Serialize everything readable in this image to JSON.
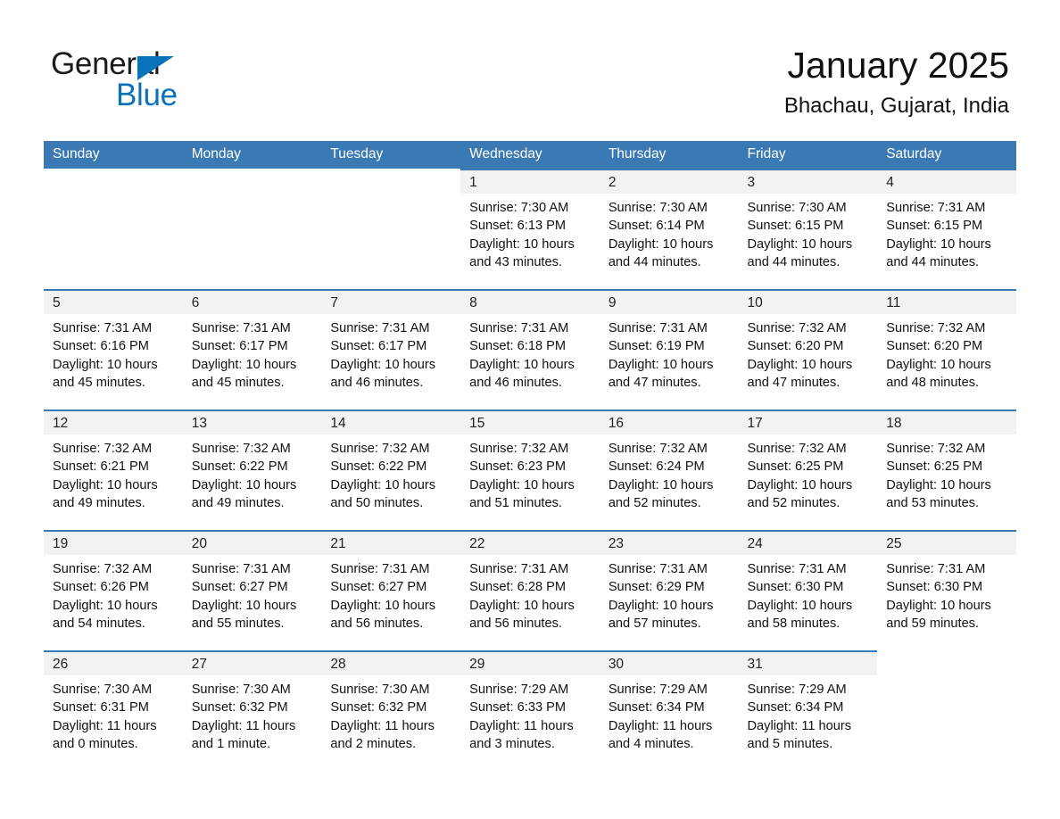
{
  "brand": {
    "name_part1": "General",
    "name_part2": "Blue",
    "accent_color": "#0a72b8"
  },
  "header": {
    "title": "January 2025",
    "subtitle": "Bhachau, Gujarat, India"
  },
  "theme": {
    "header_blue": "#3b79b5",
    "daynum_band": "#f2f2f2"
  },
  "weekday_headers": [
    "Sunday",
    "Monday",
    "Tuesday",
    "Wednesday",
    "Thursday",
    "Friday",
    "Saturday"
  ],
  "labels": {
    "sunrise_prefix": "Sunrise:",
    "sunset_prefix": "Sunset:",
    "daylight_prefix": "Daylight:"
  },
  "weeks": [
    [
      {
        "day": "",
        "blank": true
      },
      {
        "day": "",
        "blank": true
      },
      {
        "day": "",
        "blank": true
      },
      {
        "day": "1",
        "sunrise": "Sunrise: 7:30 AM",
        "sunset": "Sunset: 6:13 PM",
        "daylight_l1": "Daylight: 10 hours",
        "daylight_l2": "and 43 minutes."
      },
      {
        "day": "2",
        "sunrise": "Sunrise: 7:30 AM",
        "sunset": "Sunset: 6:14 PM",
        "daylight_l1": "Daylight: 10 hours",
        "daylight_l2": "and 44 minutes."
      },
      {
        "day": "3",
        "sunrise": "Sunrise: 7:30 AM",
        "sunset": "Sunset: 6:15 PM",
        "daylight_l1": "Daylight: 10 hours",
        "daylight_l2": "and 44 minutes."
      },
      {
        "day": "4",
        "sunrise": "Sunrise: 7:31 AM",
        "sunset": "Sunset: 6:15 PM",
        "daylight_l1": "Daylight: 10 hours",
        "daylight_l2": "and 44 minutes."
      }
    ],
    [
      {
        "day": "5",
        "sunrise": "Sunrise: 7:31 AM",
        "sunset": "Sunset: 6:16 PM",
        "daylight_l1": "Daylight: 10 hours",
        "daylight_l2": "and 45 minutes."
      },
      {
        "day": "6",
        "sunrise": "Sunrise: 7:31 AM",
        "sunset": "Sunset: 6:17 PM",
        "daylight_l1": "Daylight: 10 hours",
        "daylight_l2": "and 45 minutes."
      },
      {
        "day": "7",
        "sunrise": "Sunrise: 7:31 AM",
        "sunset": "Sunset: 6:17 PM",
        "daylight_l1": "Daylight: 10 hours",
        "daylight_l2": "and 46 minutes."
      },
      {
        "day": "8",
        "sunrise": "Sunrise: 7:31 AM",
        "sunset": "Sunset: 6:18 PM",
        "daylight_l1": "Daylight: 10 hours",
        "daylight_l2": "and 46 minutes."
      },
      {
        "day": "9",
        "sunrise": "Sunrise: 7:31 AM",
        "sunset": "Sunset: 6:19 PM",
        "daylight_l1": "Daylight: 10 hours",
        "daylight_l2": "and 47 minutes."
      },
      {
        "day": "10",
        "sunrise": "Sunrise: 7:32 AM",
        "sunset": "Sunset: 6:20 PM",
        "daylight_l1": "Daylight: 10 hours",
        "daylight_l2": "and 47 minutes."
      },
      {
        "day": "11",
        "sunrise": "Sunrise: 7:32 AM",
        "sunset": "Sunset: 6:20 PM",
        "daylight_l1": "Daylight: 10 hours",
        "daylight_l2": "and 48 minutes."
      }
    ],
    [
      {
        "day": "12",
        "sunrise": "Sunrise: 7:32 AM",
        "sunset": "Sunset: 6:21 PM",
        "daylight_l1": "Daylight: 10 hours",
        "daylight_l2": "and 49 minutes."
      },
      {
        "day": "13",
        "sunrise": "Sunrise: 7:32 AM",
        "sunset": "Sunset: 6:22 PM",
        "daylight_l1": "Daylight: 10 hours",
        "daylight_l2": "and 49 minutes."
      },
      {
        "day": "14",
        "sunrise": "Sunrise: 7:32 AM",
        "sunset": "Sunset: 6:22 PM",
        "daylight_l1": "Daylight: 10 hours",
        "daylight_l2": "and 50 minutes."
      },
      {
        "day": "15",
        "sunrise": "Sunrise: 7:32 AM",
        "sunset": "Sunset: 6:23 PM",
        "daylight_l1": "Daylight: 10 hours",
        "daylight_l2": "and 51 minutes."
      },
      {
        "day": "16",
        "sunrise": "Sunrise: 7:32 AM",
        "sunset": "Sunset: 6:24 PM",
        "daylight_l1": "Daylight: 10 hours",
        "daylight_l2": "and 52 minutes."
      },
      {
        "day": "17",
        "sunrise": "Sunrise: 7:32 AM",
        "sunset": "Sunset: 6:25 PM",
        "daylight_l1": "Daylight: 10 hours",
        "daylight_l2": "and 52 minutes."
      },
      {
        "day": "18",
        "sunrise": "Sunrise: 7:32 AM",
        "sunset": "Sunset: 6:25 PM",
        "daylight_l1": "Daylight: 10 hours",
        "daylight_l2": "and 53 minutes."
      }
    ],
    [
      {
        "day": "19",
        "sunrise": "Sunrise: 7:32 AM",
        "sunset": "Sunset: 6:26 PM",
        "daylight_l1": "Daylight: 10 hours",
        "daylight_l2": "and 54 minutes."
      },
      {
        "day": "20",
        "sunrise": "Sunrise: 7:31 AM",
        "sunset": "Sunset: 6:27 PM",
        "daylight_l1": "Daylight: 10 hours",
        "daylight_l2": "and 55 minutes."
      },
      {
        "day": "21",
        "sunrise": "Sunrise: 7:31 AM",
        "sunset": "Sunset: 6:27 PM",
        "daylight_l1": "Daylight: 10 hours",
        "daylight_l2": "and 56 minutes."
      },
      {
        "day": "22",
        "sunrise": "Sunrise: 7:31 AM",
        "sunset": "Sunset: 6:28 PM",
        "daylight_l1": "Daylight: 10 hours",
        "daylight_l2": "and 56 minutes."
      },
      {
        "day": "23",
        "sunrise": "Sunrise: 7:31 AM",
        "sunset": "Sunset: 6:29 PM",
        "daylight_l1": "Daylight: 10 hours",
        "daylight_l2": "and 57 minutes."
      },
      {
        "day": "24",
        "sunrise": "Sunrise: 7:31 AM",
        "sunset": "Sunset: 6:30 PM",
        "daylight_l1": "Daylight: 10 hours",
        "daylight_l2": "and 58 minutes."
      },
      {
        "day": "25",
        "sunrise": "Sunrise: 7:31 AM",
        "sunset": "Sunset: 6:30 PM",
        "daylight_l1": "Daylight: 10 hours",
        "daylight_l2": "and 59 minutes."
      }
    ],
    [
      {
        "day": "26",
        "sunrise": "Sunrise: 7:30 AM",
        "sunset": "Sunset: 6:31 PM",
        "daylight_l1": "Daylight: 11 hours",
        "daylight_l2": "and 0 minutes."
      },
      {
        "day": "27",
        "sunrise": "Sunrise: 7:30 AM",
        "sunset": "Sunset: 6:32 PM",
        "daylight_l1": "Daylight: 11 hours",
        "daylight_l2": "and 1 minute."
      },
      {
        "day": "28",
        "sunrise": "Sunrise: 7:30 AM",
        "sunset": "Sunset: 6:32 PM",
        "daylight_l1": "Daylight: 11 hours",
        "daylight_l2": "and 2 minutes."
      },
      {
        "day": "29",
        "sunrise": "Sunrise: 7:29 AM",
        "sunset": "Sunset: 6:33 PM",
        "daylight_l1": "Daylight: 11 hours",
        "daylight_l2": "and 3 minutes."
      },
      {
        "day": "30",
        "sunrise": "Sunrise: 7:29 AM",
        "sunset": "Sunset: 6:34 PM",
        "daylight_l1": "Daylight: 11 hours",
        "daylight_l2": "and 4 minutes."
      },
      {
        "day": "31",
        "sunrise": "Sunrise: 7:29 AM",
        "sunset": "Sunset: 6:34 PM",
        "daylight_l1": "Daylight: 11 hours",
        "daylight_l2": "and 5 minutes."
      },
      {
        "day": "",
        "blank": true
      }
    ]
  ]
}
